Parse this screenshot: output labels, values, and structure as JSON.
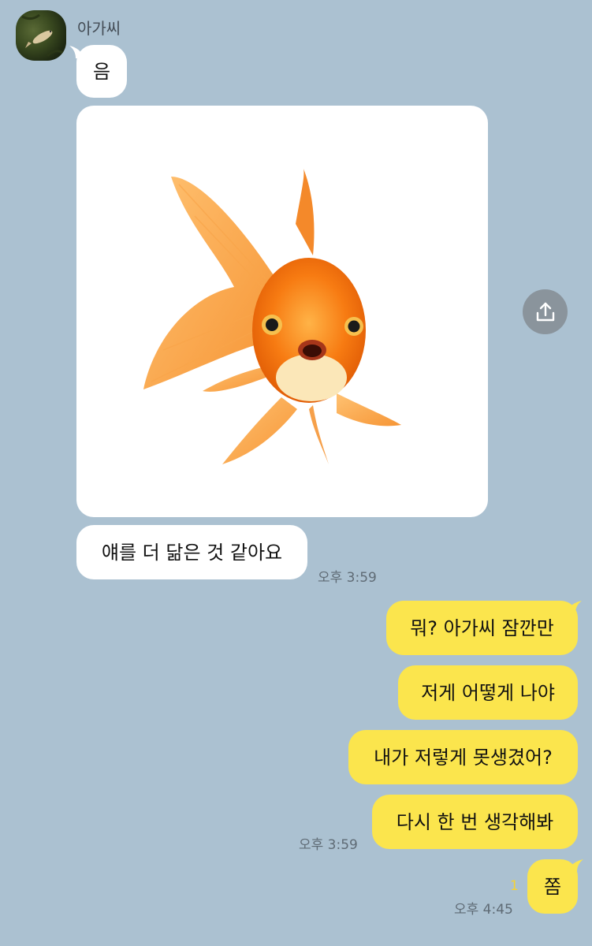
{
  "chat": {
    "sender": "아가씨",
    "incoming": [
      "음",
      "얘를 더 닮은 것 같아요"
    ],
    "incoming_time": "오후 3:59",
    "outgoing": [
      "뭐? 아가씨 잠깐만",
      "저게 어떻게 나야",
      "내가 저렇게 못생겼어?",
      "다시 한 번 생각해봐"
    ],
    "outgoing_time": "오후 3:59",
    "last_message": "쫌",
    "last_unread": "1",
    "last_time": "오후 4:45"
  },
  "icons": {
    "share": "share-icon",
    "image": "goldfish-photo",
    "avatar": "fish-avatar"
  },
  "colors": {
    "background": "#abc1d1",
    "incoming_bubble": "#ffffff",
    "outgoing_bubble": "#fbe54d",
    "unread": "#f6d233"
  }
}
